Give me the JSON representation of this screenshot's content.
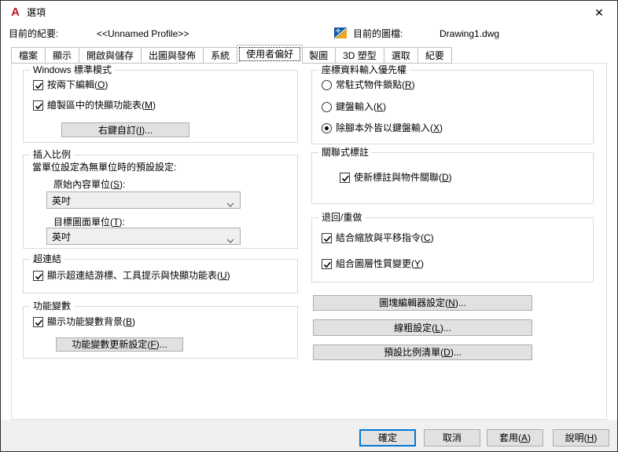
{
  "window": {
    "title": "選項",
    "close_glyph": "✕"
  },
  "colors": {
    "accent": "#0078d7",
    "app_icon_red": "#c01722",
    "dwg_blue": "#155a9e",
    "dwg_yellow": "#f2a71d",
    "button_bg": "#e1e1e1",
    "group_border": "#d9d9d9"
  },
  "header": {
    "profile_label": "目前的紀要:",
    "profile_value": "<<Unnamed Profile>>",
    "drawing_label": "目前的圖檔:",
    "drawing_value": "Drawing1.dwg"
  },
  "tabs": [
    {
      "label": "檔案",
      "active": false
    },
    {
      "label": "顯示",
      "active": false
    },
    {
      "label": "開啟與儲存",
      "active": false
    },
    {
      "label": "出圖與發佈",
      "active": false
    },
    {
      "label": "系統",
      "active": false
    },
    {
      "label": "使用者偏好",
      "active": true
    },
    {
      "label": "製圖",
      "active": false
    },
    {
      "label": "3D 塑型",
      "active": false
    },
    {
      "label": "選取",
      "active": false
    },
    {
      "label": "紀要",
      "active": false
    }
  ],
  "left": {
    "windows_behavior": {
      "legend": "Windows 標準模式",
      "checkboxes": [
        {
          "label": "按兩下編輯(O)",
          "checked": true
        },
        {
          "label": "繪製區中的快顯功能表(M)",
          "checked": true
        }
      ],
      "button": "右鍵自訂(I)..."
    },
    "insertion_scale": {
      "legend": "插入比例",
      "description": "當單位設定為無單位時的預設設定:",
      "source_label": "原始內容單位(S):",
      "source_value": "英吋",
      "target_label": "目標圖面單位(T):",
      "target_value": "英吋"
    },
    "hyperlink": {
      "legend": "超連結",
      "checkbox": {
        "label": "顯示超連結游標、工具提示與快顯功能表(U)",
        "checked": true
      }
    },
    "fields": {
      "legend": "功能變數",
      "checkbox": {
        "label": "顯示功能變數背景(B)",
        "checked": true
      },
      "button": "功能變數更新設定(F)..."
    }
  },
  "right": {
    "coord_entry": {
      "legend": "座標資料輸入優先權",
      "radios": [
        {
          "label": "常駐式物件鎖點(R)",
          "selected": false
        },
        {
          "label": "鍵盤輸入(K)",
          "selected": false
        },
        {
          "label": "除腳本外皆以鍵盤輸入(X)",
          "selected": true
        }
      ]
    },
    "assoc_dim": {
      "legend": "關聯式標註",
      "checkbox": {
        "label": "使新標註與物件關聯(D)",
        "checked": true
      }
    },
    "undo_redo": {
      "legend": "退回/重做",
      "checkboxes": [
        {
          "label": "結合縮放與平移指令(C)",
          "checked": true
        },
        {
          "label": "組合圖層性質變更(Y)",
          "checked": true
        }
      ]
    },
    "buttons": [
      "圖塊編輯器設定(N)...",
      "線粗設定(L)...",
      "預設比例清單(D)..."
    ]
  },
  "footer": {
    "ok": "確定",
    "cancel": "取消",
    "apply": "套用(A)",
    "help": "說明(H)"
  }
}
